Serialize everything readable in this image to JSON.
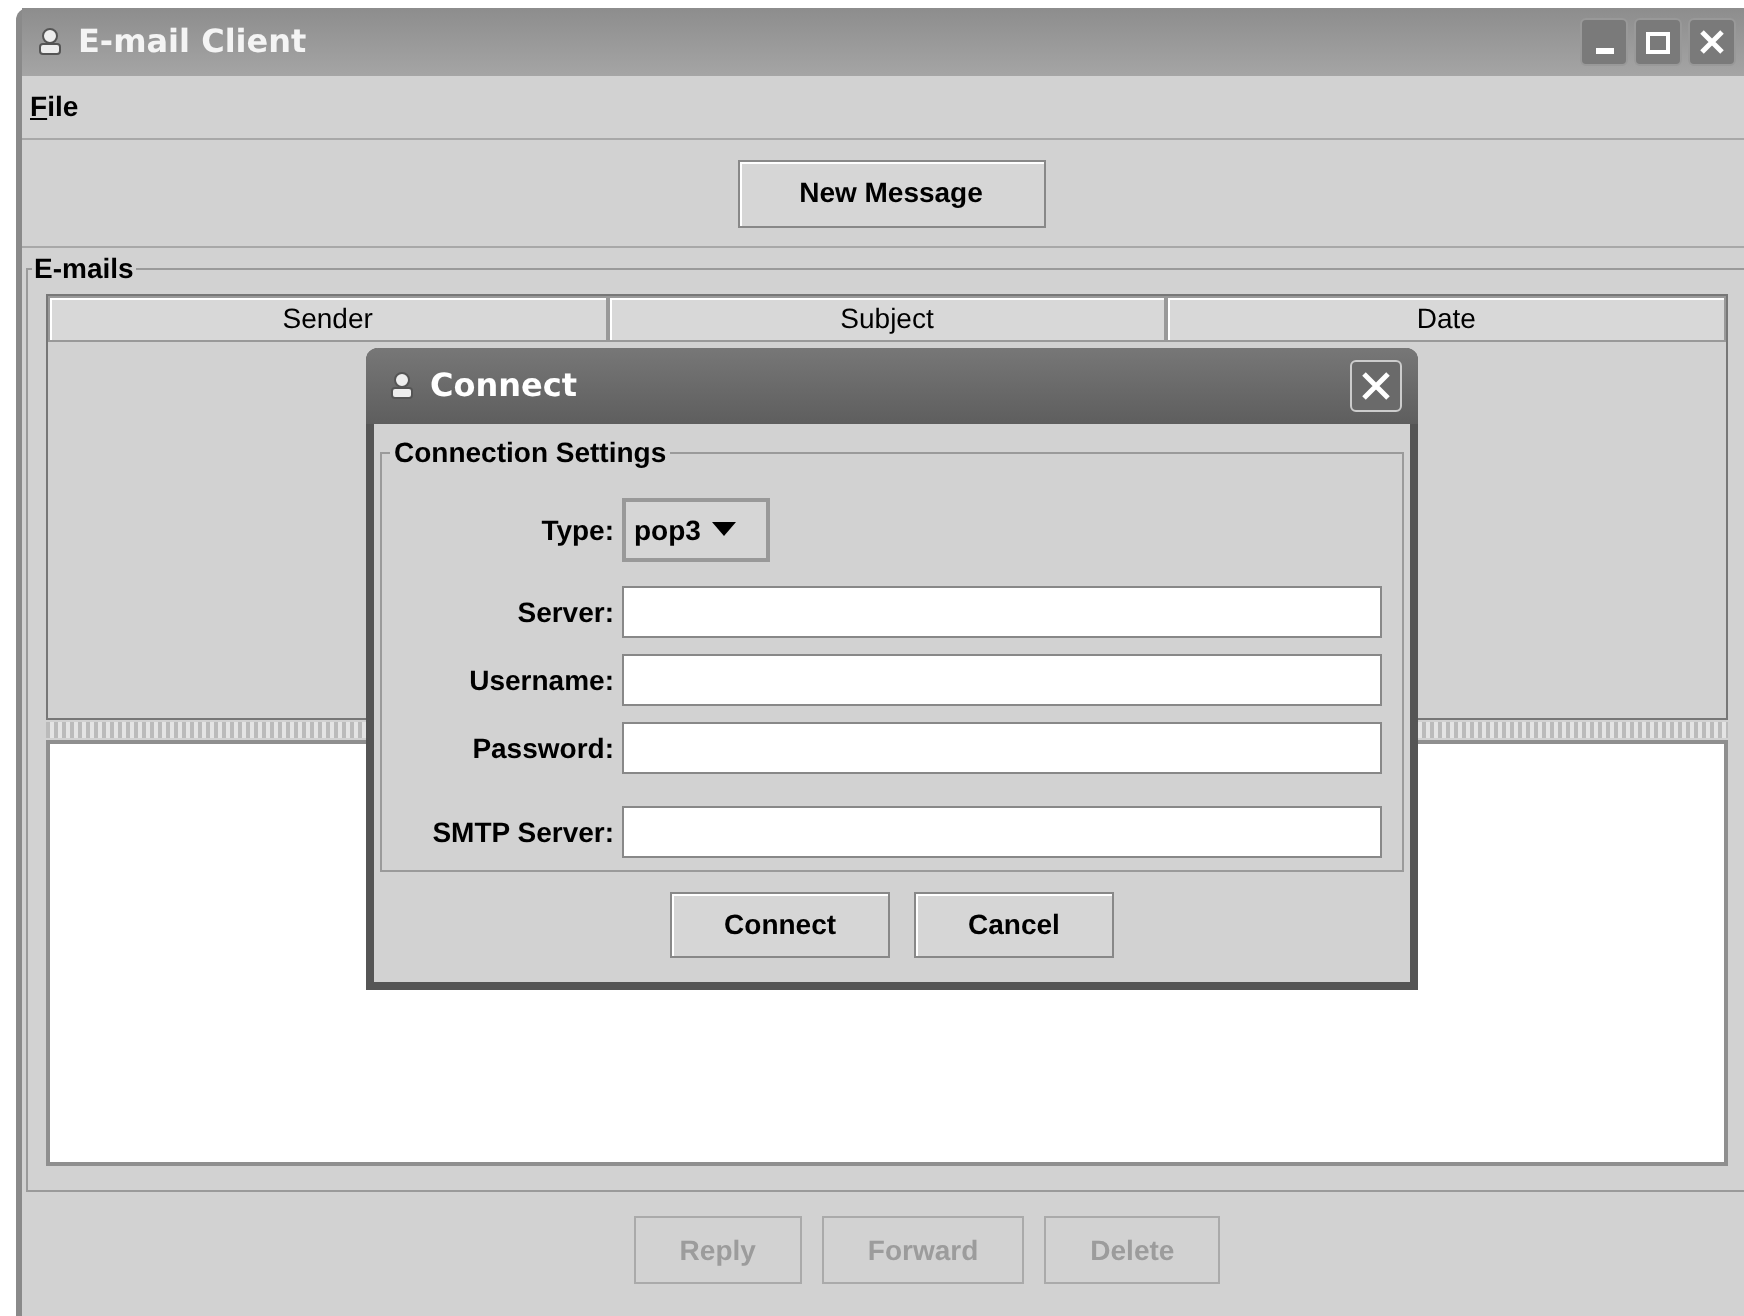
{
  "window": {
    "title": "E-mail Client"
  },
  "menu": [
    {
      "label": "File"
    }
  ],
  "toolbar": {
    "new_message": "New Message"
  },
  "emails": {
    "title": "E-mails",
    "columns": [
      "Sender",
      "Subject",
      "Date"
    ]
  },
  "actions": [
    {
      "label": "Reply",
      "disabled": true
    },
    {
      "label": "Forward",
      "disabled": true
    },
    {
      "label": "Delete",
      "disabled": true
    }
  ],
  "dialog": {
    "title": "Connect",
    "group": "Connection Settings",
    "type_label": "Type:",
    "type_value": "pop3",
    "fields": [
      {
        "label": "Server:"
      },
      {
        "label": "Username:"
      },
      {
        "label": "Password:"
      },
      {
        "label": "SMTP Server:"
      }
    ],
    "buttons": [
      "Connect",
      "Cancel"
    ]
  }
}
